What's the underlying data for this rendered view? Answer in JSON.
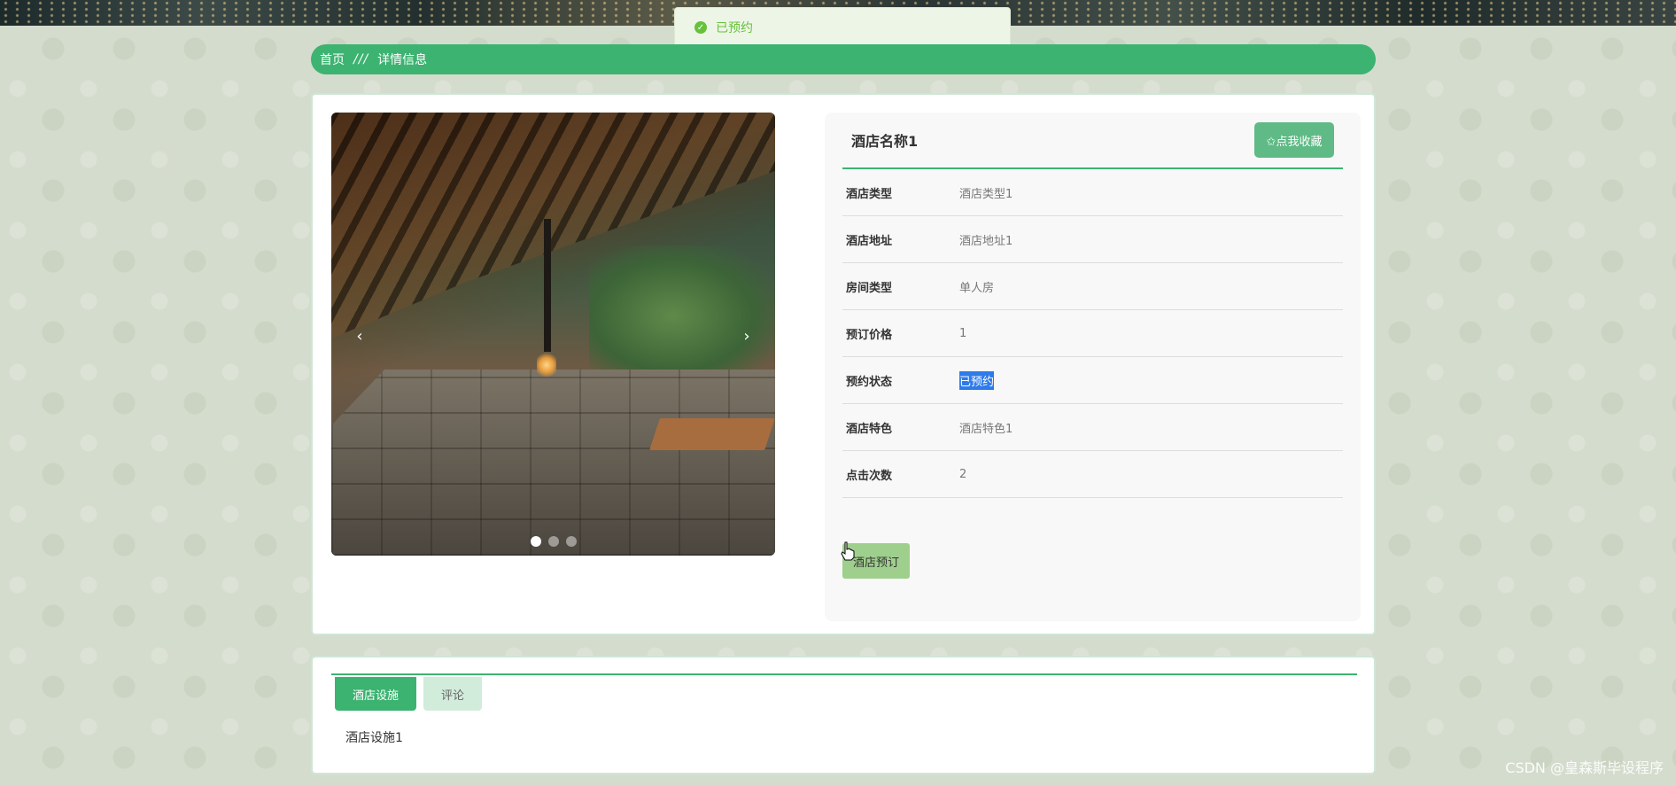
{
  "toast": {
    "message": "已预约"
  },
  "breadcrumb": {
    "home": "首页",
    "separator": "///",
    "current": "详情信息"
  },
  "hotel": {
    "name": "酒店名称1",
    "favorite_label": "✩点我收藏",
    "fields": [
      {
        "label": "酒店类型",
        "value": "酒店类型1"
      },
      {
        "label": "酒店地址",
        "value": "酒店地址1"
      },
      {
        "label": "房间类型",
        "value": "单人房"
      },
      {
        "label": "预订价格",
        "value": "1"
      },
      {
        "label": "预约状态",
        "value": "已预约"
      },
      {
        "label": "酒店特色",
        "value": "酒店特色1"
      },
      {
        "label": "点击次数",
        "value": "2"
      }
    ],
    "book_label": "酒店预订"
  },
  "carousel": {
    "prev": "‹",
    "next": "›",
    "slide_count": 3,
    "active_index": 0
  },
  "tabs": [
    {
      "label": "酒店设施",
      "active": true
    },
    {
      "label": "评论",
      "active": false
    }
  ],
  "tab_content": "酒店设施1",
  "watermark": "CSDN @皇森斯毕设程序",
  "colors": {
    "primary": "#3cb371",
    "toast_text": "#67c23a",
    "selection": "#2f7bea"
  }
}
